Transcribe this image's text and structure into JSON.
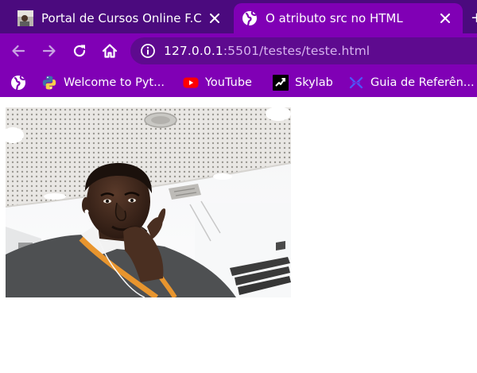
{
  "browser": {
    "tabs": [
      {
        "title": "Portal de Cursos Online F.C",
        "active": false,
        "favicon": "photo-thumbnail-icon"
      },
      {
        "title": "O atributo src no HTML",
        "active": true,
        "favicon": "globe-icon"
      }
    ],
    "toolbar": {
      "back": "arrow-left-icon",
      "forward": "arrow-right-icon",
      "reload": "reload-icon",
      "home": "home-icon"
    },
    "address_bar": {
      "host": "127.0.0.1",
      "rest": ":5501/testes/teste.html",
      "security_icon": "info-icon"
    },
    "bookmarks": [
      {
        "label": "Welcome to Pyt...",
        "icon": "python-icon"
      },
      {
        "label": "YouTube",
        "icon": "youtube-icon"
      },
      {
        "label": "Skylab",
        "icon": "skylab-icon"
      },
      {
        "label": "Guia de Referên...",
        "icon": "guide-icon"
      }
    ]
  },
  "page": {
    "image": {
      "subject": "selfie-photo"
    }
  },
  "colors": {
    "tab_strip": "#4b0a7e",
    "toolbar": "#8000b5",
    "omnibox": "#5e0a8f",
    "url_rest": "#d6b3ee"
  }
}
